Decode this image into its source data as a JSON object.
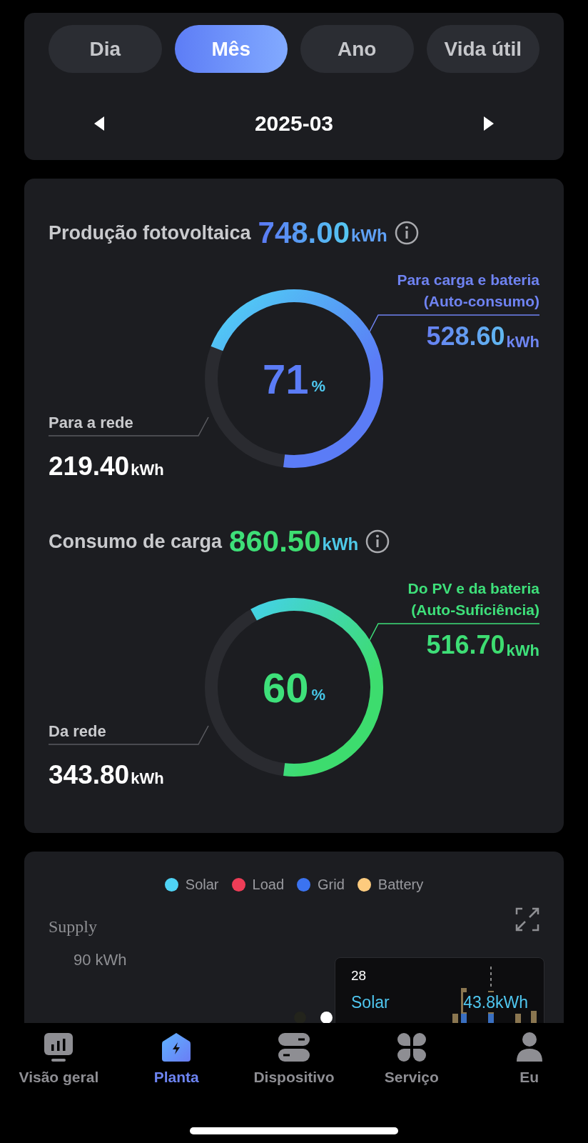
{
  "period_tabs": [
    {
      "label": "Dia",
      "selected": false
    },
    {
      "label": "Mês",
      "selected": true
    },
    {
      "label": "Ano",
      "selected": false
    },
    {
      "label": "Vida útil",
      "selected": false
    }
  ],
  "date_nav": {
    "value": "2025-03"
  },
  "sections": [
    {
      "kind": "production",
      "title": "Produção fotovoltaica",
      "total": "748.00",
      "total_unit": "kWh",
      "ring": {
        "percent": "71",
        "percent_sign": "%"
      },
      "self_part": {
        "label_lines": [
          "Para carga e bateria",
          "(Auto-consumo)"
        ],
        "value": "528.60",
        "unit": "kWh"
      },
      "grid_part": {
        "label": "Para a rede",
        "value": "219.40",
        "unit": "kWh"
      }
    },
    {
      "kind": "consumption",
      "title": "Consumo de carga",
      "total": "860.50",
      "total_unit": "kWh",
      "ring": {
        "percent": "60",
        "percent_sign": "%"
      },
      "self_part": {
        "label_lines": [
          "Do PV e da bateria",
          "(Auto-Suficiência)"
        ],
        "value": "516.70",
        "unit": "kWh"
      },
      "grid_part": {
        "label": "Da rede",
        "value": "343.80",
        "unit": "kWh"
      }
    }
  ],
  "chart": {
    "legend": [
      {
        "label": "Solar",
        "color": "#4fd3f5"
      },
      {
        "label": "Load",
        "color": "#ee3d57"
      },
      {
        "label": "Grid",
        "color": "#3b73f0"
      },
      {
        "label": "Battery",
        "color": "#fdcb7e"
      }
    ],
    "y_axis_label": "Supply",
    "y_tick": "90 kWh",
    "pager": [
      {
        "selected": false
      },
      {
        "selected": true
      }
    ],
    "tooltip": {
      "day": "28",
      "series": "Solar",
      "value": "43.8kWh"
    }
  },
  "bottom_nav": [
    {
      "kind": "overview",
      "label": "Visão geral",
      "selected": false
    },
    {
      "kind": "plant",
      "label": "Planta",
      "selected": true
    },
    {
      "kind": "device",
      "label": "Dispositivo",
      "selected": false
    },
    {
      "kind": "service",
      "label": "Serviço",
      "selected": false
    },
    {
      "kind": "me",
      "label": "Eu",
      "selected": false
    }
  ]
}
